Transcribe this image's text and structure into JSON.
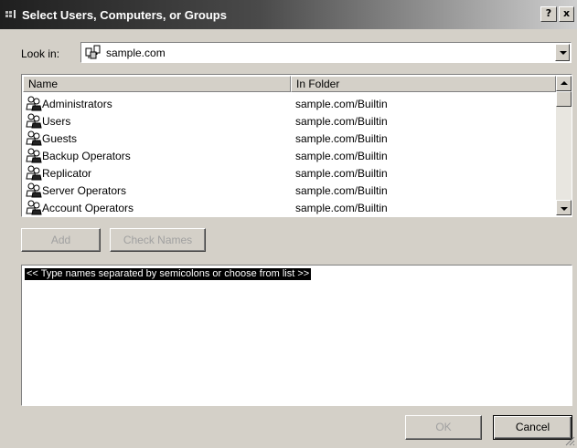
{
  "window": {
    "title": "Select Users, Computers, or Groups",
    "help_button": "?",
    "close_button": "x"
  },
  "look_in": {
    "label": "Look in:",
    "value": "sample.com",
    "icon": "domain-icon"
  },
  "list": {
    "columns": [
      "Name",
      "In Folder"
    ],
    "rows": [
      {
        "name": "Administrators",
        "folder": "sample.com/Builtin",
        "icon": "group-icon"
      },
      {
        "name": "Users",
        "folder": "sample.com/Builtin",
        "icon": "group-icon"
      },
      {
        "name": "Guests",
        "folder": "sample.com/Builtin",
        "icon": "group-icon"
      },
      {
        "name": "Backup Operators",
        "folder": "sample.com/Builtin",
        "icon": "group-icon"
      },
      {
        "name": "Replicator",
        "folder": "sample.com/Builtin",
        "icon": "group-icon"
      },
      {
        "name": "Server Operators",
        "folder": "sample.com/Builtin",
        "icon": "group-icon"
      },
      {
        "name": "Account Operators",
        "folder": "sample.com/Builtin",
        "icon": "group-icon"
      }
    ]
  },
  "actions": {
    "add_label": "Add",
    "check_names_label": "Check Names"
  },
  "names_field": {
    "placeholder": "<< Type names separated by semicolons or choose from list >>"
  },
  "footer": {
    "ok_label": "OK",
    "cancel_label": "Cancel"
  }
}
